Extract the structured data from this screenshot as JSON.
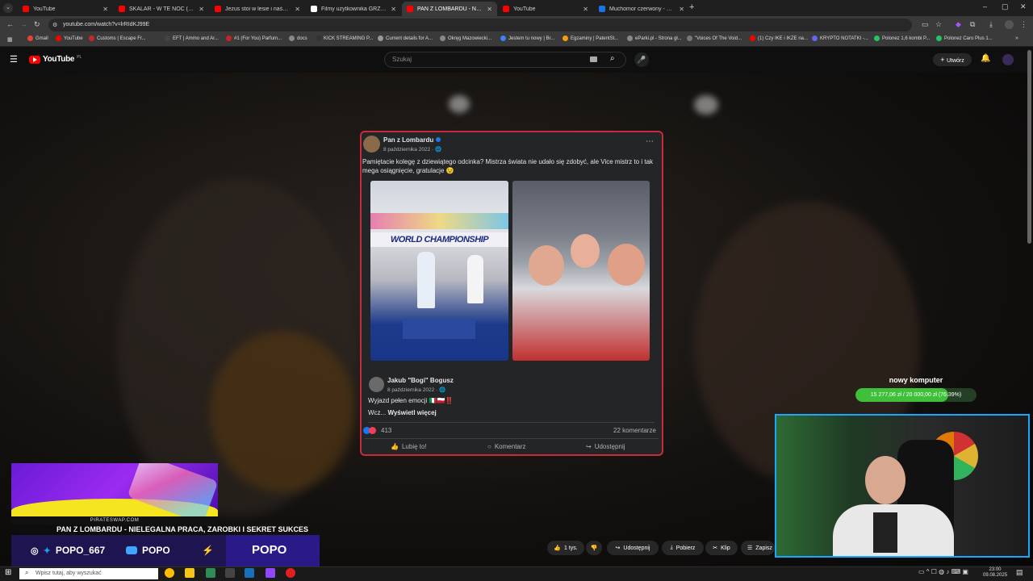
{
  "browser": {
    "tabs": [
      {
        "title": "YouTube",
        "color": "#ff0000",
        "active": false
      },
      {
        "title": "SKALAR - W TE NOC ( HIT Disco",
        "color": "#ff0000",
        "active": false
      },
      {
        "title": "Jezus stoi w lesie i naśmiewa się",
        "color": "#ff0000",
        "active": false
      },
      {
        "title": "Filmy użytkownika GRZESIU.PL",
        "color": "#ffffff",
        "active": false
      },
      {
        "title": "PAN Z LOMBARDU - NIELE",
        "color": "#ff0000",
        "active": true
      },
      {
        "title": "YouTube",
        "color": "#ff0000",
        "active": false
      },
      {
        "title": "Muchomor czerwony - Szukaj w",
        "color": "#1a73e8",
        "active": false
      }
    ],
    "url": "youtube.com/watch?v=lrRIdKJ99E",
    "bookmarks": [
      {
        "label": "Gmail",
        "color": "#ea4335"
      },
      {
        "label": "YouTube",
        "color": "#ff0000"
      },
      {
        "label": "Customs | Escape Fr...",
        "color": "#c82828"
      },
      {
        "label": "EFT | Ammo and Ar...",
        "color": "#444444"
      },
      {
        "label": "#1 (For You) Parfum...",
        "color": "#d02020"
      },
      {
        "label": "docs",
        "color": "#888888"
      },
      {
        "label": "KICK STREAMING P...",
        "color": "#333333"
      },
      {
        "label": "Current details for A...",
        "color": "#999999"
      },
      {
        "label": "Okręg Mazowiecki...",
        "color": "#888888"
      },
      {
        "label": "Jestem tu nowy | Br...",
        "color": "#3b82f6"
      },
      {
        "label": "Egzaminy | PatentSt...",
        "color": "#f59e0b"
      },
      {
        "label": "eParki.pl - Strona gł...",
        "color": "#888888"
      },
      {
        "label": "\"Voices Of The Void...",
        "color": "#777777"
      },
      {
        "label": "(1) Czy IKE i IKZE na...",
        "color": "#ff0000"
      },
      {
        "label": "KRYPTO NOTATKI -...",
        "color": "#6366f1"
      },
      {
        "label": "Polonez 1,6 kombi P...",
        "color": "#22c55e"
      },
      {
        "label": "Polonez Caro Plus 1...",
        "color": "#22c55e"
      }
    ]
  },
  "youtube": {
    "logo_text": "YouTube",
    "logo_region": "PL",
    "search_placeholder": "Szukaj",
    "create_label": "Utwórz",
    "actions": {
      "likes": "1 tys.",
      "share": "Udostępnij",
      "download": "Pobierz",
      "clip": "Klip",
      "save": "Zapisz"
    }
  },
  "fb_post": {
    "author": "Pan z Lombardu",
    "date": "8 października 2022 · ",
    "text": "Pamiętacie kolegę z dziewiątego odcinka? Mistrza świata nie udało się zdobyć, ale Vice mistrz to i tak mega osiągnięcie, gratulacje 😉",
    "photo_banner": "WORLD CHAMPIONSHIP",
    "shared_author": "Jakub \"Bogi\" Bogusz",
    "shared_date": "8 października 2022 · ",
    "shared_text": "Wyjazd pełen emocji 🇮🇹🇵🇱‼️",
    "shared_more_prefix": "Wcz... ",
    "shared_more": "Wyświetl więcej",
    "reactions": "413",
    "comments": "22 komentarze",
    "like_label": "Lubię to!",
    "comment_label": "Komentarz",
    "share_label": "Udostępnij"
  },
  "overlay": {
    "goal_title": "nowy komputer",
    "goal_text": "15 277,06 zł / 20 000,00 zł (76.39%)",
    "goal_fraction": 0.7639,
    "promo_label": "PIRATESWAP.COM",
    "video_title": "PAN Z LOMBARDU - NIELEGALNA PRACA, ZAROBKI I SEKRET SUKCES",
    "instagram": "POPO_667",
    "youtube": "POPO",
    "kick": "POPO"
  },
  "taskbar": {
    "search_placeholder": "Wpisz tutaj, aby wyszukać",
    "time": "23:00",
    "date": "09.08.2025"
  }
}
